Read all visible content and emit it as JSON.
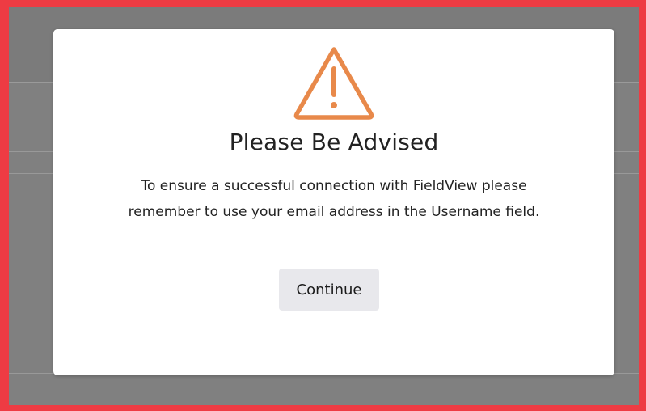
{
  "modal": {
    "icon": "warning-triangle-icon",
    "title": "Please Be Advised",
    "message": "To ensure a successful connection with FieldView please remember to use your email address in the Username field.",
    "continue_label": "Continue"
  },
  "colors": {
    "frame_border": "#ee3b43",
    "overlay": "#808080",
    "warning_icon": "#e8894a",
    "button_bg": "#e8e8ec"
  }
}
